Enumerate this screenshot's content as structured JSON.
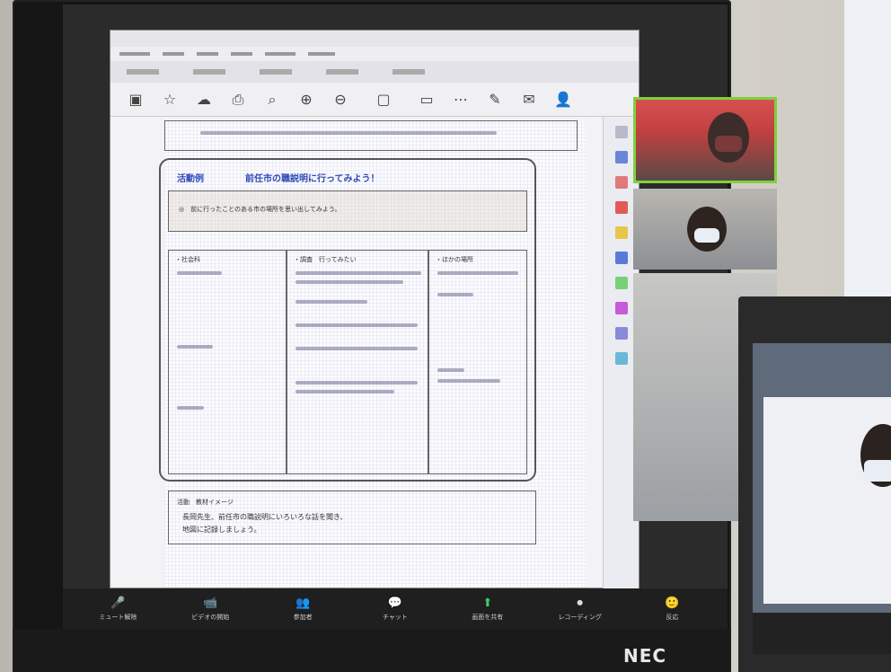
{
  "monitor_brand": "NEC",
  "pdf_viewer": {
    "title": "",
    "page": {
      "section_number": "活動例",
      "section_heading": "前任市の職説明に行ってみよう！",
      "note_text": "◎　前に行ったことのある市の場所を思い出してみよう。",
      "col_left_header": "・社会科",
      "col_mid_header": "・調査　行ってみたい",
      "col_right_header": "・ほかの場所",
      "footer_title": "活動　教材イメージ",
      "footer_line_1": "長岡先生、前任市の職説明にいろいろな話を聞き、",
      "footer_line_2": "地図に記録しましょう。"
    }
  },
  "zoom_controls": [
    {
      "icon": "🎤",
      "label": "ミュート解除"
    },
    {
      "icon": "📹",
      "label": "ビデオの開始"
    },
    {
      "icon": "👥",
      "label": "参加者"
    },
    {
      "icon": "💬",
      "label": "チャット"
    },
    {
      "icon": "⬆",
      "label": "画面を共有"
    },
    {
      "icon": "⏺",
      "label": "レコーディング"
    },
    {
      "icon": "🙂",
      "label": "反応"
    }
  ]
}
